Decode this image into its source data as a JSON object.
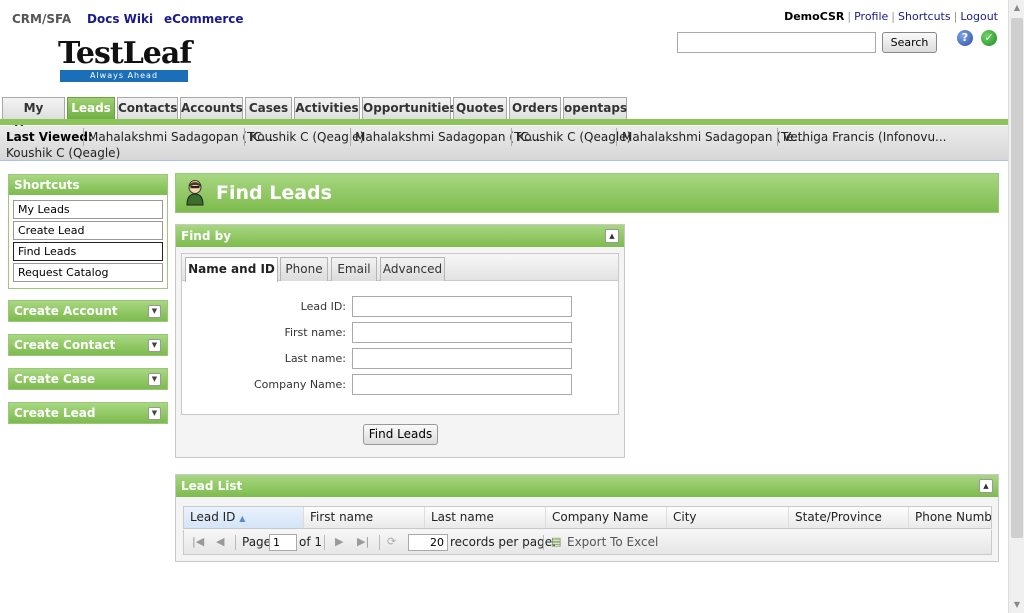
{
  "header": {
    "top_links": [
      "CRM/SFA",
      "Docs Wiki",
      "eCommerce"
    ],
    "user": "DemoCSR",
    "user_links": [
      "Profile",
      "Shortcuts",
      "Logout"
    ],
    "search_placeholder": "",
    "search_button": "Search",
    "logo_main": "TestLeaf",
    "logo_tagline": "Always Ahead"
  },
  "tabs": [
    "My Home",
    "Leads",
    "Contacts",
    "Accounts",
    "Cases",
    "Activities",
    "Opportunities",
    "Quotes",
    "Orders",
    "opentaps"
  ],
  "active_tab": "Leads",
  "last_viewed": {
    "label": "Last Viewed:",
    "items": [
      "Mahalakshmi Sadagopan (TC...",
      "Koushik C (Qeagle)",
      "Mahalakshmi Sadagopan (TC...",
      "Koushik C (Qeagle)",
      "Mahalakshmi Sadagopan (Te...",
      "Vethiga Francis (Infonovu...",
      "Koushik C (Qeagle)"
    ]
  },
  "sidebar": {
    "shortcuts_title": "Shortcuts",
    "shortcuts": [
      "My Leads",
      "Create Lead",
      "Find Leads",
      "Request Catalog"
    ],
    "sections": [
      "Create Account",
      "Create Contact",
      "Create Case",
      "Create Lead"
    ]
  },
  "main": {
    "title": "Find Leads",
    "findby": {
      "title": "Find by",
      "tabs": [
        "Name and ID",
        "Phone",
        "Email",
        "Advanced"
      ],
      "fields": [
        {
          "label": "Lead ID:",
          "value": ""
        },
        {
          "label": "First name:",
          "value": ""
        },
        {
          "label": "Last name:",
          "value": ""
        },
        {
          "label": "Company Name:",
          "value": ""
        }
      ],
      "button": "Find Leads"
    },
    "leadlist": {
      "title": "Lead List",
      "columns": [
        "Lead ID",
        "First name",
        "Last name",
        "Company Name",
        "City",
        "State/Province",
        "Phone Number"
      ],
      "pager": {
        "page_label": "Page",
        "page_value": "1",
        "of_label": "of 1",
        "per_page_value": "20",
        "per_page_label": "records per page.",
        "export_label": "Export To Excel"
      }
    }
  }
}
